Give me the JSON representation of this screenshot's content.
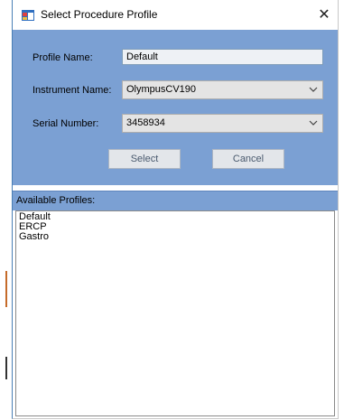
{
  "window": {
    "title": "Select Procedure Profile",
    "close_glyph": "✕"
  },
  "form": {
    "profile_name_label": "Profile Name:",
    "profile_name_value": "Default",
    "instrument_name_label": "Instrument Name:",
    "instrument_name_value": "OlympusCV190",
    "serial_number_label": "Serial Number:",
    "serial_number_value": "3458934"
  },
  "buttons": {
    "select_label": "Select",
    "cancel_label": "Cancel"
  },
  "profiles": {
    "header": "Available Profiles:",
    "items": [
      "Default",
      "ERCP",
      "Gastro"
    ]
  },
  "colors": {
    "panel_blue": "#7ba0d3",
    "field_bg": "#eef1f5",
    "combo_bg": "#e4e4e4"
  },
  "icons": {
    "app": "window-app-icon",
    "close": "close-icon",
    "dropdown": "chevron-down-icon"
  }
}
